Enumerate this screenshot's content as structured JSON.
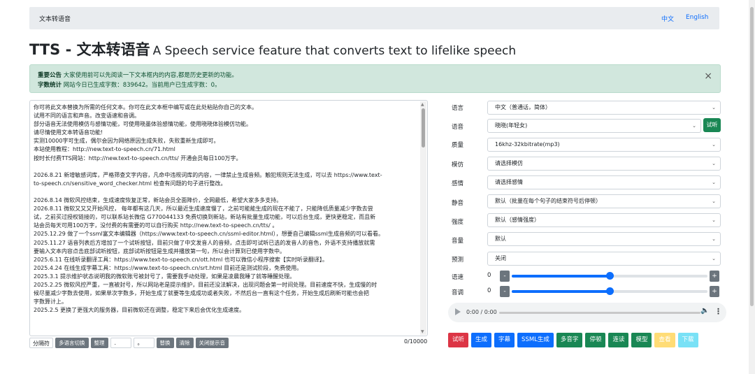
{
  "navbar": {
    "brand": "文本转语音",
    "lang_zh": "中文",
    "lang_en": "English"
  },
  "title": {
    "main": "TTS - 文本转语音",
    "sub": "A Speech service feature that converts text to lifelike speech"
  },
  "alert": {
    "notice_label": "重要公告",
    "notice_text": "大家使用前可以先阅读一下文本框内的内容,都是历史更新的功能。",
    "stats_label": "字数统计",
    "stats_text": "网站今日已生成字数：839642。当前用户已生成字数：0。",
    "close": "×"
  },
  "textarea": {
    "lines": [
      "你可将此文本替换为所需的任何文本。你可在此文本框中编写或在此处粘贴你自己的文本。",
      "试用不同的语言和声音。改变语速和音调。",
      "部分语音无法使用模仿与感情功能，可使用晓墨体验感情功能，使用晓晓体验模仿功能。",
      "请尽情使用文本转语音功能!",
      "实测10000字可生成，偶尔会因为网络原因生成失败，失败重新生成即可。",
      "本站使用教程：http://new.text-to-speech.cn/71.html",
      "按时长付费TTS网站：http://new.text-to-speech.cn/tts/ 开通会员每日100万字。",
      "",
      "2026.8.21 新增敏感词库，严格筛查文字内容，凡命中违规词库的内容，一律禁止生成音频。触犯规则无法生成，可以去 https://www.text-",
      "to-speech.cn/sensitive_word_checker.html 检查有问题的句子进行整改。",
      "",
      "2026.8.14 微软风控结束，生成速度恢复正常，新站会员全面降价，全网最低，希望大家多多支持。",
      "2026.8.11 微软又又又开始风控， 每年都有这几天，所以最近生成速度慢了，之前可能能生成的现在不能了，只能降低质量减少字数去尝",
      "试，之前买过授权链接的，可以联系站长微信 G770044133 免费切换到新站，新站有批量生成功能，可以后台生成，更快更稳定，而且新",
      "站会员每天可用100万字，没付费的有需要的可以自行购买 http://new.text-to-speech.cn/tts/ 。",
      "2025.12.29 做了一个ssml富文本编辑器（https://www.text-to-speech.cn/ssml-editor.html），想要自己编辑ssml生成音频的可以看看。",
      "2025.11.27 语音列表后方增加了一个试听按钮，目前只做了中文发音人的音频，点击即可试听已选的发音人的音色，外语不支持播放就需",
      "要输入文本内容点击底部试听按钮，底部试听按钮是生成并播放第一句，所以会计算到已使用字数中。",
      "2025.6.11 在线听录翻译工具：https://www.text-to-speech.cn/ott.html 也可以微信小程序搜索【实时听录翻译】。",
      "2025.4.24 在线生成字幕工具：https://www.text-to-speech.cn/srt.html 目前还是测试阶段，免费使用。",
      "2025.3.1 提示维护状态说明我的微软账号被封号了，需要我手动处理，如果是凌晨我睡了就等睡醒处理。",
      "2025.2.25 微软风控严重，一直被封号，所以网站老是提示维护，目前还没法解决，出现问题会第一时间处理。目前速度不快，生成慢的时",
      "候尽量减少字数去使用，如果单次字数多，开始生成了就要等生成成功或者失败，不然后台一直有这个任务，开始生成后刷新可能也会把",
      "字数算计上。",
      "2025.2.5 更换了更强大的服务器，目前微软还在调整，稳定下来后会优化生成速度。"
    ]
  },
  "tools": {
    "separator": "分隔符",
    "multi_lang": "多语言切换",
    "organize": "整理",
    "input1": ".",
    "input2": "。",
    "replace": "替换",
    "clear": "清除",
    "close_tip": "关闭提示音"
  },
  "counter": "0/10000",
  "settings": {
    "language": {
      "label": "语言",
      "value": "中文（普通话，简体）"
    },
    "voice": {
      "label": "语音",
      "value": "晓晓(年轻女)",
      "try": "试听"
    },
    "quality": {
      "label": "质量",
      "value": "16khz-32kbitrate(mp3)"
    },
    "imitate": {
      "label": "模仿",
      "value": "请选择模仿"
    },
    "emotion": {
      "label": "感情",
      "value": "请选择感情"
    },
    "silence": {
      "label": "静音",
      "value": "默认（批量在每个句子的结束符号后停顿）"
    },
    "intensity": {
      "label": "强度",
      "value": "默认（感情强度）"
    },
    "volume": {
      "label": "音量",
      "value": "默认"
    },
    "preview": {
      "label": "预测",
      "value": "关闭"
    },
    "rate": {
      "label": "语速",
      "value": "0",
      "level": 0.5
    },
    "pitch": {
      "label": "音调",
      "value": "0",
      "level": 0.5
    }
  },
  "audio": {
    "time": "0:00 / 0:00"
  },
  "actions": [
    "试听",
    "生成",
    "字幕",
    "SSML生成",
    "多音字",
    "停顿",
    "连读",
    "模型",
    "查看",
    "下载"
  ],
  "colors": {
    "accent": "#0d6efd",
    "success": "#198754",
    "danger": "#dc3545",
    "alert_bg": "#d1e7dd"
  }
}
